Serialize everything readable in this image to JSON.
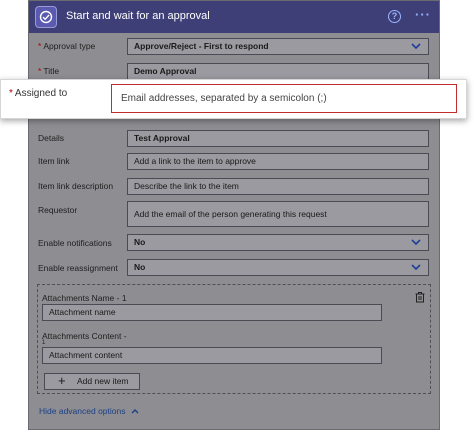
{
  "header": {
    "title": "Start and wait for an approval",
    "help_icon": "?",
    "more_icon": "···"
  },
  "fields": {
    "approval_type": {
      "label": "Approval type",
      "value": "Approve/Reject - First to respond"
    },
    "title": {
      "label": "Title",
      "value": "Demo Approval"
    },
    "details": {
      "label": "Details",
      "value": "Test Approval"
    },
    "item_link": {
      "label": "Item link",
      "placeholder": "Add a link to the item to approve"
    },
    "item_link_description": {
      "label": "Item link description",
      "placeholder": "Describe the link to the item"
    },
    "requestor": {
      "label": "Requestor",
      "placeholder": "Add the email of the person generating this request"
    },
    "enable_notifications": {
      "label": "Enable notifications",
      "value": "No"
    },
    "enable_reassignment": {
      "label": "Enable reassignment",
      "value": "No"
    }
  },
  "popup": {
    "label": "Assigned to",
    "placeholder": "Email addresses, separated by a semicolon (;)"
  },
  "attachments": {
    "name_label": "Attachments Name - 1",
    "name_placeholder": "Attachment name",
    "content_label": "Attachments Content -",
    "content_label_cont": "1",
    "content_placeholder": "Attachment content",
    "add_button": "Add new item"
  },
  "footer": {
    "advanced_toggle": "Hide advanced options"
  },
  "required_mark": "*",
  "colors": {
    "header_bg": "#3f3f78",
    "dim_panel": "#8e8e92",
    "error_border": "#c22e2e",
    "link": "#1b3f86"
  }
}
